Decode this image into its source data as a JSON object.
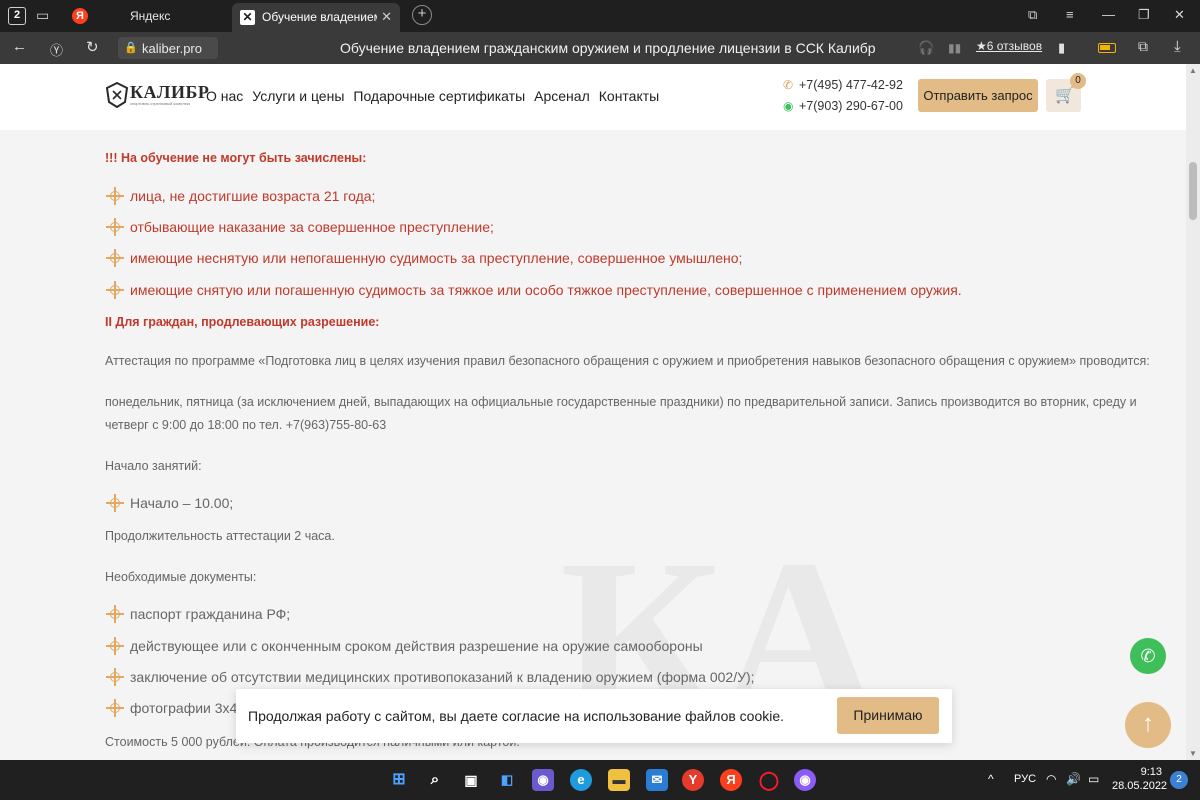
{
  "browser": {
    "tab_count": "2",
    "tabs": [
      {
        "label": "Яндекс"
      },
      {
        "label": "Обучение владением г"
      }
    ],
    "yandex_logo": "Я",
    "active_tab_favicon": "✕",
    "url": "kaliber.pro",
    "page_title": "Обучение владением гражданским оружием и продление лицензии в ССК Калибр",
    "reviews": "★6 отзывов",
    "icons": [
      "sidebar-icon",
      "new-group-icon",
      "back-icon",
      "yandex-icon",
      "reload-icon",
      "lock-icon",
      "headphones-icon",
      "bookmark-icon",
      "battery-icon",
      "share-icon",
      "download-icon"
    ]
  },
  "site": {
    "logo_text": "КАЛИБР",
    "logo_subtitle": "спортивно-стрелковый комплекс",
    "nav": [
      "О нас",
      "Услуги и цены",
      "Подарочные сертификаты",
      "Арсенал",
      "Контакты"
    ],
    "phones": [
      "+7(495) 477-42-92",
      "+7(903) 290-67-00"
    ],
    "request_button": "Отправить запрос",
    "cart_count": "0"
  },
  "content": {
    "not_enrolled_heading": "!!! На обучение не могут быть зачислены:",
    "not_enrolled_items": [
      "лица, не достигшие возраста 21 года;",
      "отбывающие наказание за совершенное преступление;",
      "имеющие неснятую или непогашенную судимость за преступление, совершенное умышлено;",
      "имеющие снятую или погашенную судимость за тяжкое или особо тяжкое преступление, совершенное с применением оружия."
    ],
    "renewal_heading": "II Для граждан, продлевающих разрешение:",
    "attestation_text": "Аттестация по программе «Подготовка лиц в целях изучения правил безопасного обращения с оружием и приобретения навыков безопасного обращения с оружием» проводится:",
    "schedule_line1": "понедельник, пятница (за исключением дней, выпадающих на официальные государственные праздники) по предварительной записи. Запись производится во вторник, среду и",
    "schedule_line2": "четверг с 9:00 до 18:00 по тел. +7(963)755-80-63",
    "start_label": "Начало занятий:",
    "start_items": [
      "Начало – 10.00;"
    ],
    "duration": "Продолжительность аттестации 2 часа.",
    "docs_label": "Необходимые документы:",
    "docs_items": [
      "паспорт гражданина РФ;",
      "действующее или с оконченным сроком действия разрешение на оружие самообороны",
      "заключение об отсутствии медицинских противопоказаний к владению оружием (форма 002/У);",
      "фотографии 3х4"
    ],
    "cost": "Стоимость 5 000 рублей. Оплата производится наличными или картой."
  },
  "cookie": {
    "text": "Продолжая работу с сайтом, вы даете согласие на использование файлов cookie.",
    "accept": "Принимаю"
  },
  "taskbar": {
    "lang": "РУС",
    "time": "9:13",
    "date": "28.05.2022",
    "notifications": "2",
    "yandex_app": "Я",
    "icons": [
      "windows-start-icon",
      "search-icon",
      "task-view-icon",
      "widgets-icon",
      "chat-icon",
      "edge-icon",
      "explorer-icon",
      "mail-icon",
      "yandex-browser-icon",
      "yandex-icon",
      "opera-icon",
      "alice-icon"
    ]
  },
  "colors": {
    "accent": "#e2bb86",
    "warning_red": "#c0392b",
    "whatsapp": "#3fbf5a"
  }
}
